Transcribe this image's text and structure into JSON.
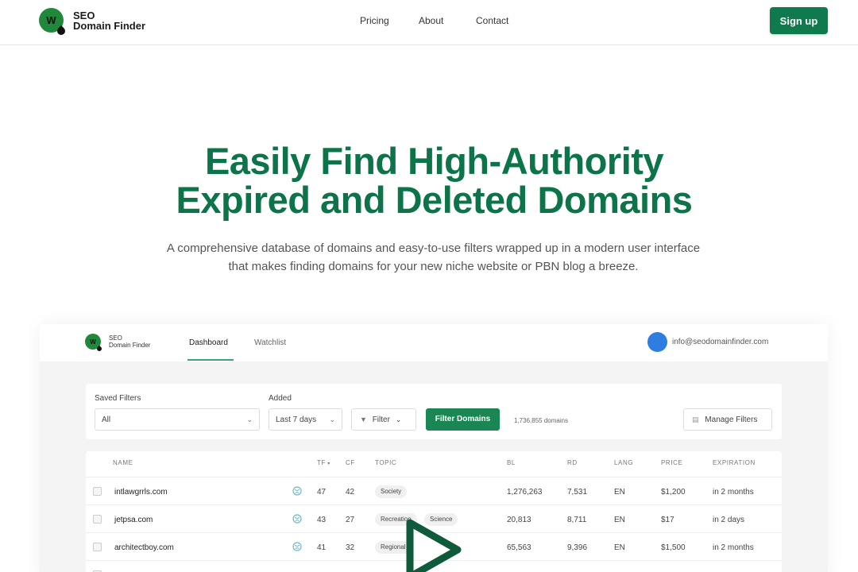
{
  "nav": {
    "logo_line1": "SEO",
    "logo_line2": "Domain Finder",
    "logo_letter": "W",
    "links": [
      "Pricing",
      "About",
      "Contact"
    ],
    "signup": "Sign up"
  },
  "hero": {
    "title_line1": "Easily Find High-Authority",
    "title_line2": "Expired and Deleted Domains",
    "sub_line1": "A comprehensive database of domains and easy-to-use filters wrapped up in a modern user interface",
    "sub_line2": "that makes finding domains for your new niche website or PBN blog a breeze."
  },
  "preview": {
    "logo_line1": "SEO",
    "logo_line2": "Domain Finder",
    "tabs": [
      "Dashboard",
      "Watchlist"
    ],
    "email": "info@seodomainfinder.com",
    "filters": {
      "saved_label": "Saved Filters",
      "saved_value": "All",
      "added_label": "Added",
      "added_value": "Last 7 days",
      "filter_btn": "Filter",
      "primary_btn": "Filter Domains",
      "count": "1,736,855 domains",
      "manage_btn": "Manage Filters"
    },
    "table": {
      "headers": [
        "NAME",
        "TF",
        "CF",
        "TOPIC",
        "BL",
        "RD",
        "LANG",
        "PRICE",
        "EXPIRATION"
      ],
      "rows": [
        {
          "name": "intlawgrrls.com",
          "tf": "47",
          "cf": "42",
          "topics": [
            "Society"
          ],
          "bl": "1,276,263",
          "rd": "7,531",
          "lang": "EN",
          "price": "$1,200",
          "exp": "in 2 months"
        },
        {
          "name": "jetpsa.com",
          "tf": "43",
          "cf": "27",
          "topics": [
            "Recreation",
            "Science"
          ],
          "bl": "20,813",
          "rd": "8,711",
          "lang": "EN",
          "price": "$17",
          "exp": "in 2 days"
        },
        {
          "name": "architectboy.com",
          "tf": "41",
          "cf": "32",
          "topics": [
            "Regional"
          ],
          "bl": "65,563",
          "rd": "9,396",
          "lang": "EN",
          "price": "$1,500",
          "exp": "in 2 months"
        }
      ]
    }
  },
  "colors": {
    "brand": "#0c7448",
    "button": "#0f7a4d",
    "avatar": "#2f7de1"
  }
}
